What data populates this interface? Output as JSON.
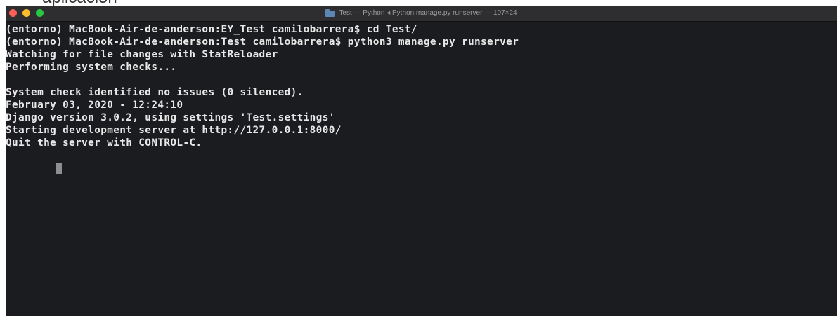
{
  "above_text": "aplicación",
  "window": {
    "title": "Test — Python ◂ Python manage.py runserver — 107×24"
  },
  "terminal": {
    "lines": [
      "(entorno) MacBook-Air-de-anderson:EY_Test camilobarrera$ cd Test/",
      "(entorno) MacBook-Air-de-anderson:Test camilobarrera$ python3 manage.py runserver",
      "Watching for file changes with StatReloader",
      "Performing system checks...",
      "",
      "System check identified no issues (0 silenced).",
      "February 03, 2020 - 12:24:10",
      "Django version 3.0.2, using settings 'Test.settings'",
      "Starting development server at http://127.0.0.1:8000/",
      "Quit the server with CONTROL-C."
    ]
  },
  "colors": {
    "background": "#1b1c1f",
    "text": "#e8e8e8",
    "titlebar": "#2e2e31",
    "close": "#ff5f57",
    "minimize": "#febc2e",
    "zoom": "#28c840"
  },
  "icons": {
    "folder": "folder-icon"
  }
}
